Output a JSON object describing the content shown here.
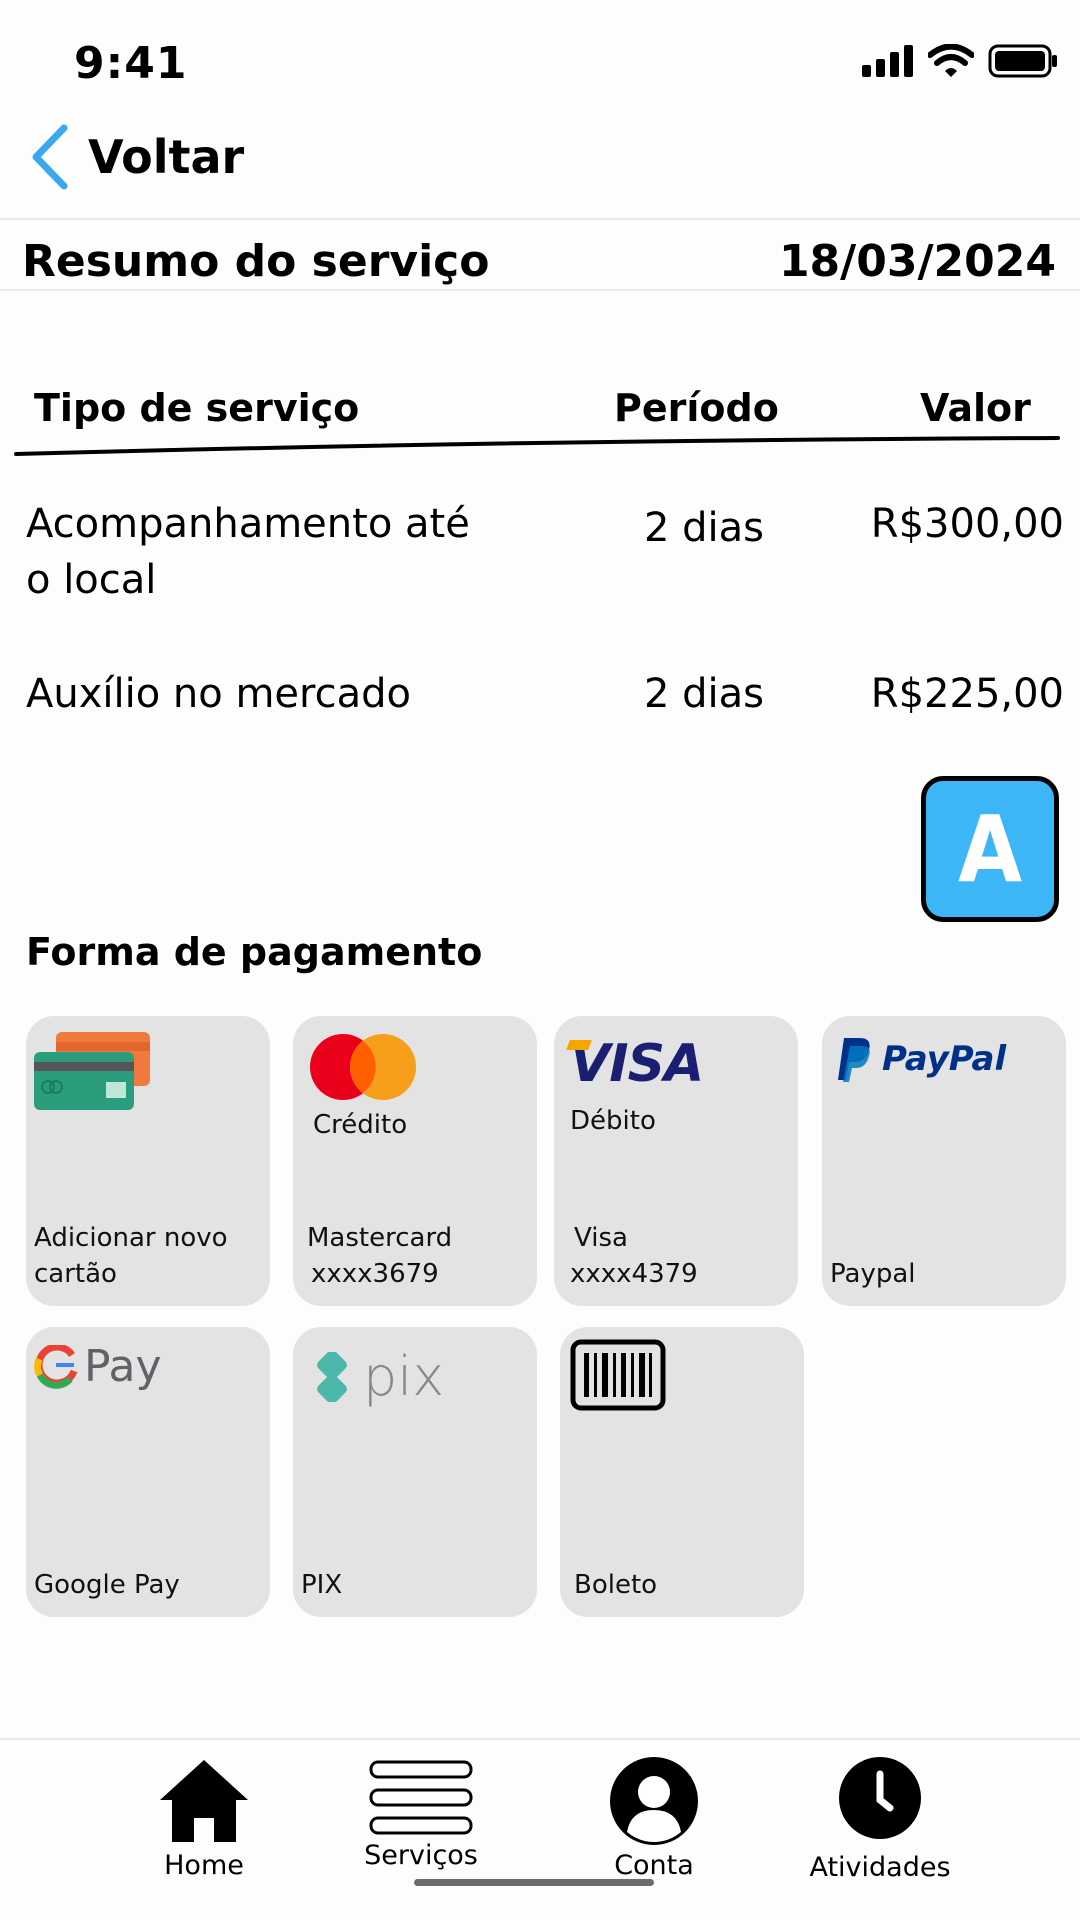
{
  "status": {
    "time": "9:41"
  },
  "header": {
    "back_label": "Voltar"
  },
  "summary": {
    "title": "Resumo do serviço",
    "date": "18/03/2024"
  },
  "table": {
    "headers": {
      "service": "Tipo de serviço",
      "period": "Período",
      "value": "Valor"
    },
    "rows": [
      {
        "service_line1": "Acompanhamento até",
        "service_line2": "o local",
        "period": "2 dias",
        "value": "R$300,00"
      },
      {
        "service_line1": "Auxílio no mercado",
        "period": "2 dias",
        "value": "R$225,00"
      }
    ]
  },
  "badge": {
    "letter": "A"
  },
  "payment": {
    "title": "Forma de pagamento",
    "options": [
      {
        "label_line1": "Adicionar novo",
        "label_line2": "cartão",
        "icon": "credit-cards-icon"
      },
      {
        "subtitle": "Crédito",
        "label_line1": "Mastercard",
        "label_line2": "xxxx3679",
        "icon": "mastercard-icon"
      },
      {
        "subtitle": "Débito",
        "label_line1": "Visa",
        "label_line2": "xxxx4379",
        "logo_text": "VISA",
        "icon": "visa-icon"
      },
      {
        "label_line1": "Paypal",
        "logo_text": "PayPal",
        "icon": "paypal-icon"
      },
      {
        "label_line1": "Google Pay",
        "logo_text": "Pay",
        "icon": "google-pay-icon"
      },
      {
        "label_line1": "PIX",
        "logo_text": "pix",
        "icon": "pix-icon"
      },
      {
        "label_line1": "Boleto",
        "icon": "barcode-icon"
      }
    ]
  },
  "nav": {
    "items": [
      {
        "label": "Home",
        "icon": "home-icon"
      },
      {
        "label": "Serviços",
        "icon": "menu-icon"
      },
      {
        "label": "Conta",
        "icon": "user-icon"
      },
      {
        "label": "Atividades",
        "icon": "clock-icon"
      }
    ]
  },
  "colors": {
    "accent": "#3cb6f6",
    "card_bg": "#e3e3e3",
    "back_arrow": "#3aa8f0",
    "visa_blue": "#1a1f71",
    "paypal_blue": "#003087"
  }
}
